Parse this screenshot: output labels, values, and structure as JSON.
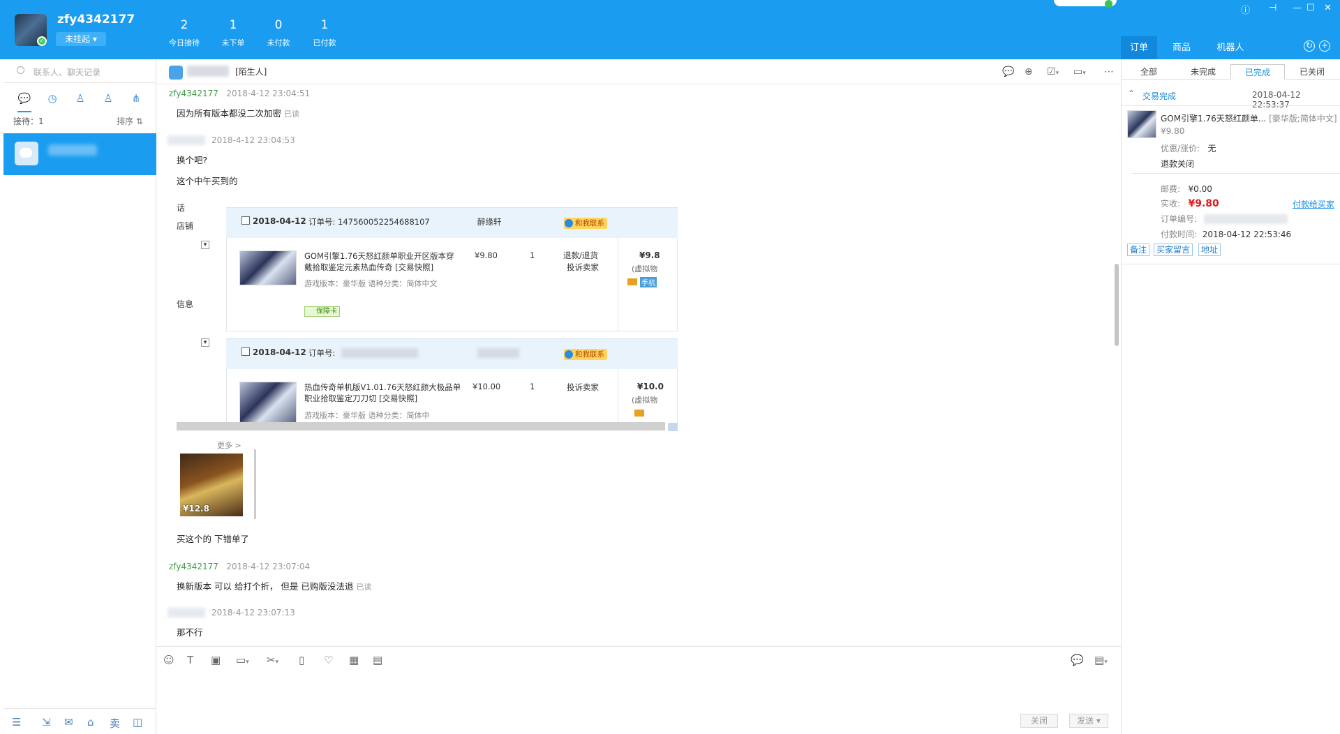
{
  "header": {
    "username": "zfy4342177",
    "status": "未挂起 ▾",
    "stats": [
      {
        "value": "2",
        "label": "今日接待"
      },
      {
        "value": "1",
        "label": "未下单"
      },
      {
        "value": "0",
        "label": "未付款"
      },
      {
        "value": "1",
        "label": "已付款"
      }
    ],
    "right_tabs": [
      "订单",
      "商品",
      "机器人"
    ]
  },
  "left": {
    "search_placeholder": "联系人、聊天记录",
    "reception": "接待：1",
    "sort": "排序 ⇅"
  },
  "chat": {
    "stranger_tag": "[陌生人]",
    "messages": [
      {
        "sender": "zfy4342177",
        "time": "2018-4-12 23:04:51",
        "text": "因为所有版本都没二次加密",
        "read": "已读"
      },
      {
        "time": "2018-4-12 23:04:53",
        "text1": "换个吧?",
        "text2": "这个中午买到的"
      },
      {
        "text": "买这个的 下错单了"
      },
      {
        "sender": "zfy4342177",
        "time": "2018-4-12 23:07:04",
        "text": "换新版本 可以 给打个折， 但是 已购版没法退",
        "read": "已读"
      },
      {
        "time": "2018-4-12 23:07:13",
        "text": "那不行"
      }
    ],
    "screenshot": {
      "side": [
        "话",
        "店铺",
        "信息"
      ],
      "orders": [
        {
          "date": "2018-04-12",
          "order_no_label": "订单号:",
          "order_no": "147560052254688107",
          "seller": "醉缘轩",
          "contact": "和我联系",
          "title": "GOM引擎1.76天怒红颜单职业开区版本穿戴拾取鉴定元素热血传奇 [交易快照]",
          "attrs": "游戏版本：豪华版  语种分类：简体中文",
          "guarantee": "保障卡",
          "price": "¥9.80",
          "qty": "1",
          "action1": "退款/退货",
          "action2": "投诉卖家",
          "total": "¥9.8",
          "virtual": "(虚拟物",
          "phone": "手机"
        },
        {
          "date": "2018-04-12",
          "order_no_label": "订单号:",
          "contact": "和我联系",
          "title": "热血传奇单机版V1.01.76天怒红颜大极品单职业拾取鉴定刀刀切 [交易快照]",
          "attrs": "游戏版本：豪华版  语种分类：简体中",
          "price": "¥10.00",
          "qty": "1",
          "action2": "投诉卖家",
          "total": "¥10.0",
          "virtual": "(虚拟物"
        }
      ]
    },
    "card": {
      "more": "更多 >",
      "price": "¥12.8"
    },
    "buttons": {
      "close": "关闭",
      "send": "发送 ▾"
    }
  },
  "right": {
    "subtabs": [
      "全部",
      "未完成",
      "已完成",
      "已关闭"
    ],
    "status": "交易完成",
    "time": "2018-04-12 22:53:37",
    "product_title": "GOM引擎1.76天怒红颜单...",
    "product_variant": "[豪华版;简体中文]",
    "product_price": "¥9.80",
    "discount_label": "优惠/涨价:",
    "discount_value": "无",
    "refund": "退款关闭",
    "postage_label": "邮费:",
    "postage_value": "¥0.00",
    "paid_label": "实收:",
    "paid_value": "¥9.80",
    "pay_link": "付款给买家",
    "order_no_label": "订单编号:",
    "paytime_label": "付款时间:",
    "paytime_value": "2018-04-12 22:53:46",
    "buttons": [
      "备注",
      "买家留言",
      "地址"
    ]
  }
}
